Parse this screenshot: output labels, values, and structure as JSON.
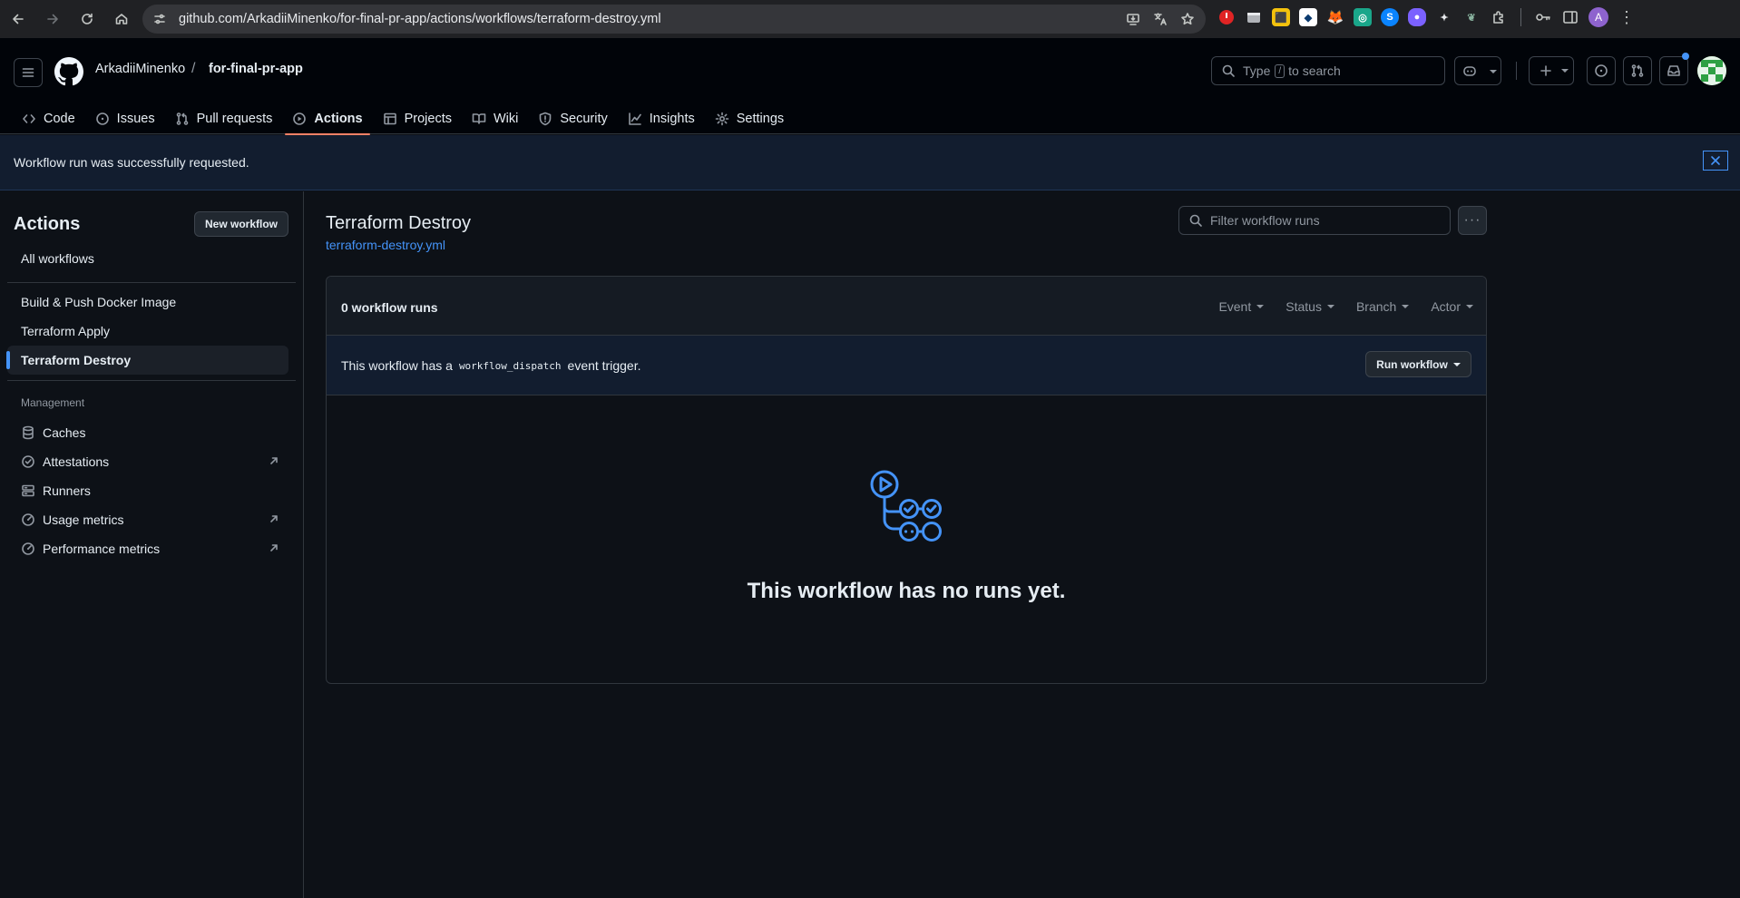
{
  "browser": {
    "url": "github.com/ArkadiiMinenko/for-final-pr-app/actions/workflows/terraform-destroy.yml",
    "profile_initial": "A"
  },
  "header": {
    "owner": "ArkadiiMinenko",
    "separator": "/",
    "repo": "for-final-pr-app",
    "search_placeholder_prefix": "Type",
    "search_key": "/",
    "search_placeholder_suffix": "to search"
  },
  "tabs": [
    {
      "label": "Code",
      "icon": "code-icon"
    },
    {
      "label": "Issues",
      "icon": "issue-icon"
    },
    {
      "label": "Pull requests",
      "icon": "pull-request-icon"
    },
    {
      "label": "Actions",
      "icon": "play-icon",
      "active": true
    },
    {
      "label": "Projects",
      "icon": "table-icon"
    },
    {
      "label": "Wiki",
      "icon": "book-icon"
    },
    {
      "label": "Security",
      "icon": "shield-icon"
    },
    {
      "label": "Insights",
      "icon": "graph-icon"
    },
    {
      "label": "Settings",
      "icon": "gear-icon"
    }
  ],
  "flash": {
    "message": "Workflow run was successfully requested."
  },
  "sidebar": {
    "title": "Actions",
    "new_workflow": "New workflow",
    "all_workflows": "All workflows",
    "workflows": [
      {
        "label": "Build & Push Docker Image"
      },
      {
        "label": "Terraform Apply"
      },
      {
        "label": "Terraform Destroy",
        "active": true
      }
    ],
    "management_heading": "Management",
    "management": [
      {
        "label": "Caches",
        "icon": "database-icon",
        "external": false
      },
      {
        "label": "Attestations",
        "icon": "verified-icon",
        "external": true
      },
      {
        "label": "Runners",
        "icon": "server-icon",
        "external": false
      },
      {
        "label": "Usage metrics",
        "icon": "meter-icon",
        "external": true
      },
      {
        "label": "Performance metrics",
        "icon": "meter-icon",
        "external": true
      }
    ]
  },
  "main": {
    "title": "Terraform Destroy",
    "file": "terraform-destroy.yml",
    "filter_placeholder": "Filter workflow runs",
    "run_count": "0 workflow runs",
    "filters": [
      "Event",
      "Status",
      "Branch",
      "Actor"
    ],
    "dispatch_prefix": "This workflow has a",
    "dispatch_code": "workflow_dispatch",
    "dispatch_suffix": "event trigger.",
    "run_workflow": "Run workflow",
    "blankslate": "This workflow has no runs yet."
  },
  "colors": {
    "accent": "#4493f8",
    "tab_underline": "#f78166",
    "background": "#0d1117"
  }
}
